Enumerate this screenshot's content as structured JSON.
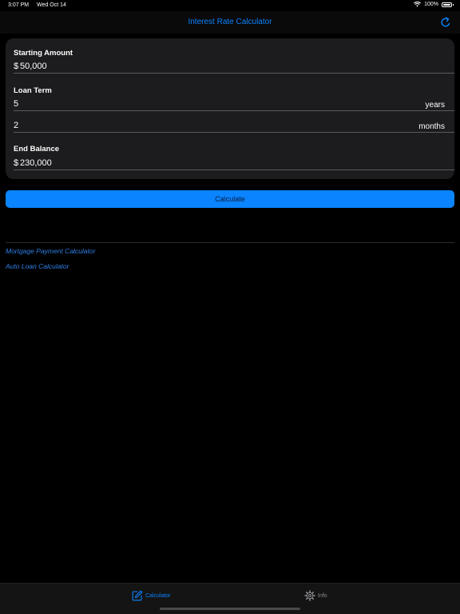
{
  "status_bar": {
    "time": "3:07 PM",
    "date": "Wed Oct 14",
    "battery": "100%",
    "battery_level": 1.0
  },
  "nav": {
    "title": "Interest Rate Calculator",
    "refresh_icon": "refresh-icon"
  },
  "form": {
    "starting_amount": {
      "label": "Starting Amount",
      "prefix": "$",
      "value": "50,000"
    },
    "loan_term": {
      "label": "Loan Term",
      "years_value": "5",
      "years_suffix": "years",
      "months_value": "2",
      "months_suffix": "months"
    },
    "end_balance": {
      "label": "End Balance",
      "prefix": "$",
      "value": "230,000"
    }
  },
  "calculate_button": {
    "label": "Calculate"
  },
  "links": [
    {
      "label": "Mortgage Payment Calculator"
    },
    {
      "label": "Auto Loan Calculator"
    }
  ],
  "tab_bar": {
    "tabs": [
      {
        "label": "Calculator",
        "icon": "pencil-square-icon",
        "selected": true
      },
      {
        "label": "Info",
        "icon": "gear-icon",
        "selected": false
      }
    ]
  },
  "colors": {
    "accent": "#0a84ff",
    "background": "#000000",
    "card": "#1c1c1e",
    "tab_inactive": "#8e8e93"
  }
}
